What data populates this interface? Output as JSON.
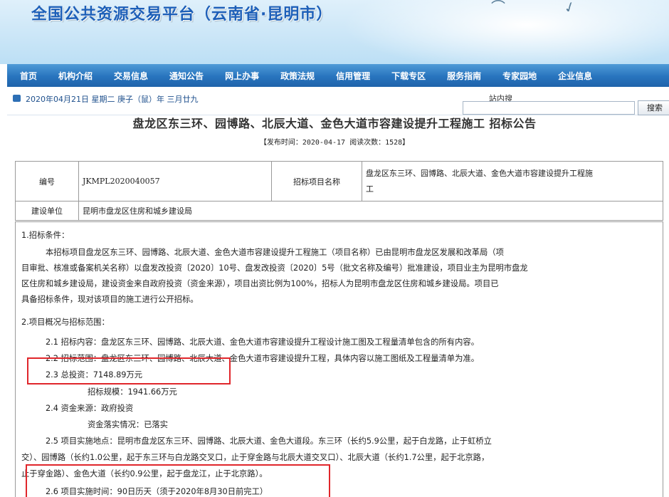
{
  "banner": {
    "title": "全国公共资源交易平台（云南省·昆明市）"
  },
  "nav": [
    {
      "label": "首页"
    },
    {
      "label": "机构介绍"
    },
    {
      "label": "交易信息"
    },
    {
      "label": "通知公告"
    },
    {
      "label": "网上办事"
    },
    {
      "label": "政策法规"
    },
    {
      "label": "信用管理"
    },
    {
      "label": "下载专区"
    },
    {
      "label": "服务指南"
    },
    {
      "label": "专家园地"
    },
    {
      "label": "企业信息"
    }
  ],
  "datebar": {
    "date": "2020年04月21日  星期二  庚子（鼠）年  三月廿九",
    "site_search_label": "站内搜",
    "search_value": "",
    "search_button": "搜索"
  },
  "article": {
    "title": "盘龙区东三环、园博路、北辰大道、金色大道市容建设提升工程施工  招标公告",
    "meta": "【发布时间：2020-04-17  阅读次数：1528】"
  },
  "info_table": {
    "code_label": "编号",
    "code_value": "JKMPL2020040057",
    "project_label": "招标项目名称",
    "project_value_line1": "盘龙区东三环、园博路、北辰大道、金色大道市容建设提升工程施",
    "project_value_line2": "工",
    "unit_label": "建设单位",
    "unit_value": "昆明市盘龙区住房和城乡建设局"
  },
  "body": {
    "s1_title": "1.招标条件：",
    "s1_l1": "本招标项目盘龙区东三环、园博路、北辰大道、金色大道市容建设提升工程施工（项目名称）已由昆明市盘龙区发展和改革局（项",
    "s1_l2": "目审批、核准或备案机关名称）以盘发改投资〔2020〕10号、盘发改投资〔2020〕5号（批文名称及编号）批准建设，项目业主为昆明市盘龙",
    "s1_l3": "区住房和城乡建设局，建设资金来自政府投资（资金来源），项目出资比例为100%，招标人为昆明市盘龙区住房和城乡建设局。项目已",
    "s1_l4": "具备招标条件，现对该项目的施工进行公开招标。",
    "s2_title": "2.项目概况与招标范围：",
    "s2_1": "2.1  招标内容：盘龙区东三环、园博路、北辰大道、金色大道市容建设提升工程设计施工图及工程量清单包含的所有内容。",
    "s2_2": "2.2  招标范围：盘龙区东三环、园博路、北辰大道、金色大道市容建设提升工程，具体内容以施工图纸及工程量清单为准。",
    "s2_3": "2.3  总投资：7148.89万元",
    "s2_3b": "招标规模：1941.66万元",
    "s2_4": "2.4  资金来源：政府投资",
    "s2_4b": "资金落实情况：已落实",
    "s2_5_l1": "2.5  项目实施地点：昆明市盘龙区东三环、园博路、北辰大道、金色大道段。东三环（长约5.9公里，起于白龙路，止于虹桥立",
    "s2_5_l2": "交）、园博路（长约1.0公里，起于东三环与白龙路交叉口，止于穿金路与北辰大道交叉口）、北辰大道（长约1.7公里，起于北京路，",
    "s2_5_l3": "止于穿金路）、金色大道（长约0.9公里，起于盘龙江，止于北京路）。",
    "s2_6": "2.6  项目实施时间：90日历天（须于2020年8月30日前完工）"
  },
  "colors": {
    "nav_blue": "#2874be",
    "title_blue": "#1d5fb8",
    "highlight_red": "#e0262b"
  }
}
